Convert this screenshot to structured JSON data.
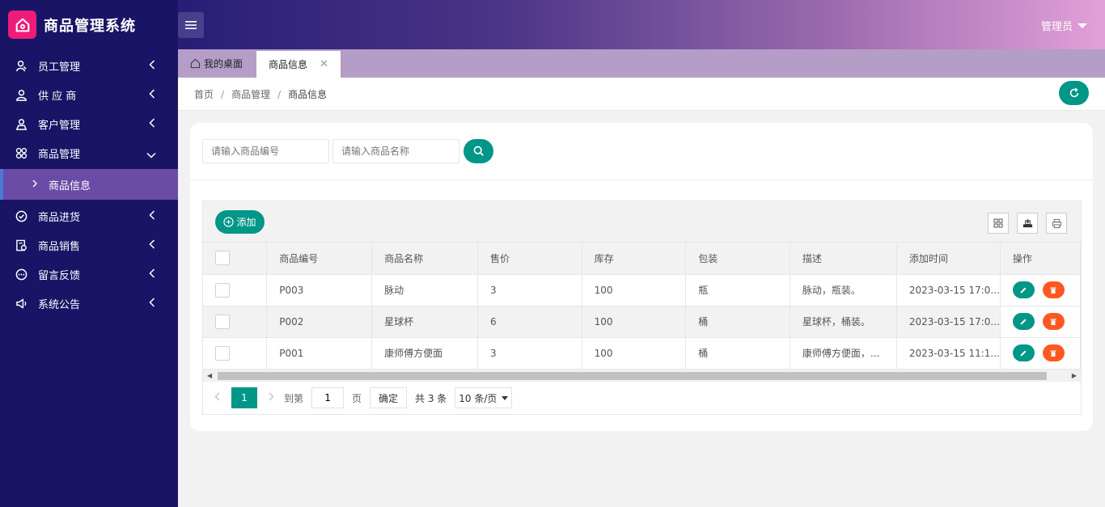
{
  "app": {
    "title": "商品管理系统",
    "admin_label": "管理员"
  },
  "sidebar": {
    "items": [
      {
        "label": "员工管理"
      },
      {
        "label": "供 应 商"
      },
      {
        "label": "客户管理"
      },
      {
        "label": "商品管理"
      },
      {
        "label": "商品信息"
      },
      {
        "label": "商品进货"
      },
      {
        "label": "商品销售"
      },
      {
        "label": "留言反馈"
      },
      {
        "label": "系统公告"
      }
    ]
  },
  "tabs": {
    "home": "我的桌面",
    "active": "商品信息"
  },
  "breadcrumb": {
    "items": [
      "首页",
      "商品管理",
      "商品信息"
    ],
    "separator": "/"
  },
  "search": {
    "code_placeholder": "请输入商品编号",
    "name_placeholder": "请输入商品名称"
  },
  "toolbar": {
    "add_label": "添加"
  },
  "table": {
    "headers": [
      "商品编号",
      "商品名称",
      "售价",
      "库存",
      "包装",
      "描述",
      "添加时间",
      "操作"
    ],
    "rows": [
      {
        "code": "P003",
        "name": "脉动",
        "price": "3",
        "stock": "100",
        "pack": "瓶",
        "desc": "脉动，瓶装。",
        "time": "2023-03-15 17:0..."
      },
      {
        "code": "P002",
        "name": "星球杯",
        "price": "6",
        "stock": "100",
        "pack": "桶",
        "desc": "星球杯，桶装。",
        "time": "2023-03-15 17:0..."
      },
      {
        "code": "P001",
        "name": "康师傅方便面",
        "price": "3",
        "stock": "100",
        "pack": "桶",
        "desc": "康师傅方便面，...",
        "time": "2023-03-15 11:1..."
      }
    ]
  },
  "pager": {
    "current": "1",
    "goto_label": "到第",
    "page_value": "1",
    "page_label": "页",
    "confirm_label": "确定",
    "total_label": "共 3 条",
    "page_size": "10 条/页"
  },
  "colors": {
    "primary": "#009688",
    "danger": "#ff5722",
    "sidebar": "#1a1466",
    "logo": "#ee1c78"
  },
  "icons": [
    "home-icon",
    "menu-icon",
    "user-icon",
    "supplier-icon",
    "customer-icon",
    "goods-icon",
    "purchase-icon",
    "sales-icon",
    "feedback-icon",
    "notice-icon",
    "refresh-icon",
    "search-icon",
    "plus-icon",
    "columns-icon",
    "export-icon",
    "print-icon",
    "edit-icon",
    "delete-icon"
  ]
}
